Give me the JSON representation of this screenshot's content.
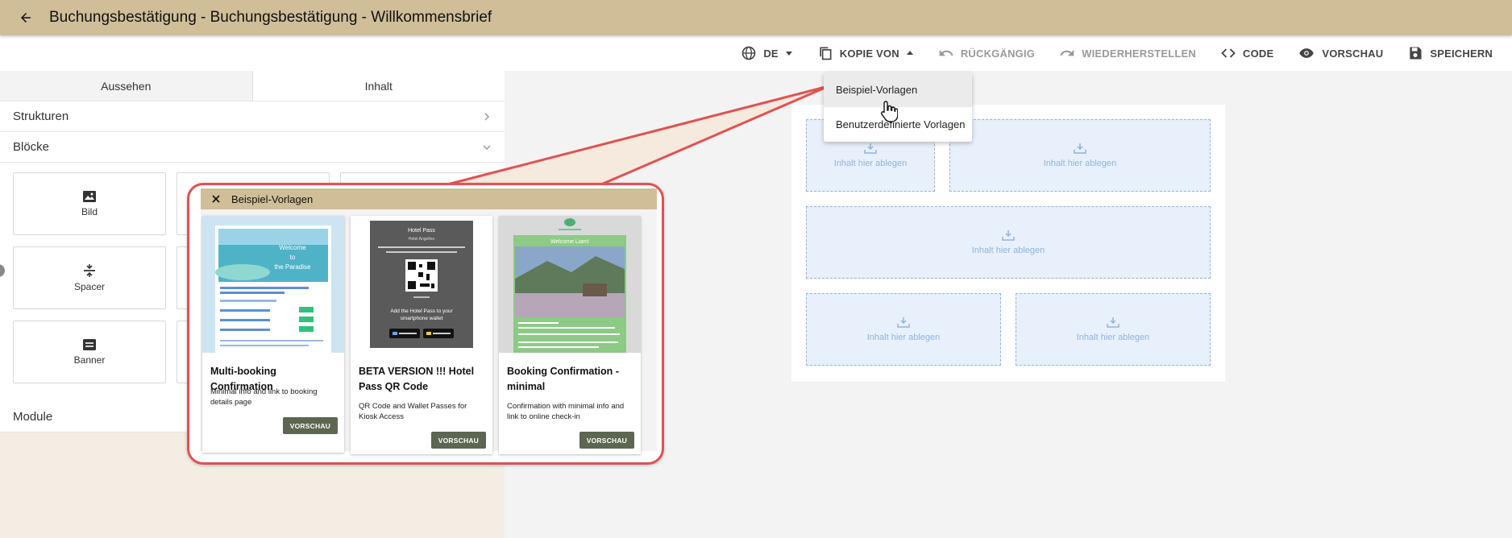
{
  "header": {
    "title": "Buchungsbestätigung - Buchungsbestätigung - Willkommensbrief",
    "back_icon": "arrow-left-icon"
  },
  "toolbar": {
    "language": "DE",
    "copy_from": "KOPIE VON",
    "undo": "RÜCKGÄNGIG",
    "redo": "WIEDERHERSTELLEN",
    "code": "CODE",
    "preview": "VORSCHAU",
    "save": "SPEICHERN"
  },
  "left_panel": {
    "tabs": [
      {
        "label": "Aussehen"
      },
      {
        "label": "Inhalt"
      }
    ],
    "sections": {
      "structures": "Strukturen",
      "blocks": "Blöcke",
      "modules": "Module"
    },
    "blocks": [
      {
        "label": "Bild"
      },
      {
        "label": "Spacer"
      },
      {
        "label": "Banner"
      }
    ]
  },
  "canvas": {
    "drop_label": "Inhalt hier ablegen"
  },
  "dropdown": {
    "items": [
      {
        "label": "Beispiel-Vorlagen"
      },
      {
        "label": "Benutzerdefinierte Vorlagen"
      }
    ]
  },
  "popup": {
    "title": "Beispiel-Vorlagen",
    "templates": [
      {
        "title": "Multi-booking Confirmation",
        "description": "Minimal info and link to booking details page",
        "button": "VORSCHAU"
      },
      {
        "title": "BETA VERSION !!! Hotel Pass QR Code",
        "description": "QR Code and Wallet Passes for Kiosk Access",
        "button": "VORSCHAU"
      },
      {
        "title": "Booking Confirmation - minimal",
        "description": "Confirmation with minimal info and link to online check-in",
        "button": "VORSCHAU"
      }
    ],
    "thumb1": {
      "heading_line1": "Welcome",
      "heading_line2": "to",
      "heading_line3": "the Paradise"
    },
    "thumb2": {
      "heading": "Hotel Pass",
      "subheading": "Hotel Angeline",
      "cta_line1": "Add the Hotel Pass to your",
      "cta_line2": "smartphone wallet"
    },
    "thumb3": {
      "heading": "Welcome Liam!"
    }
  },
  "colors": {
    "header_bg": "#cfbe98",
    "accent_red": "#e05252",
    "button_bg": "#5c6651",
    "drop_border": "#8fb4dd"
  }
}
